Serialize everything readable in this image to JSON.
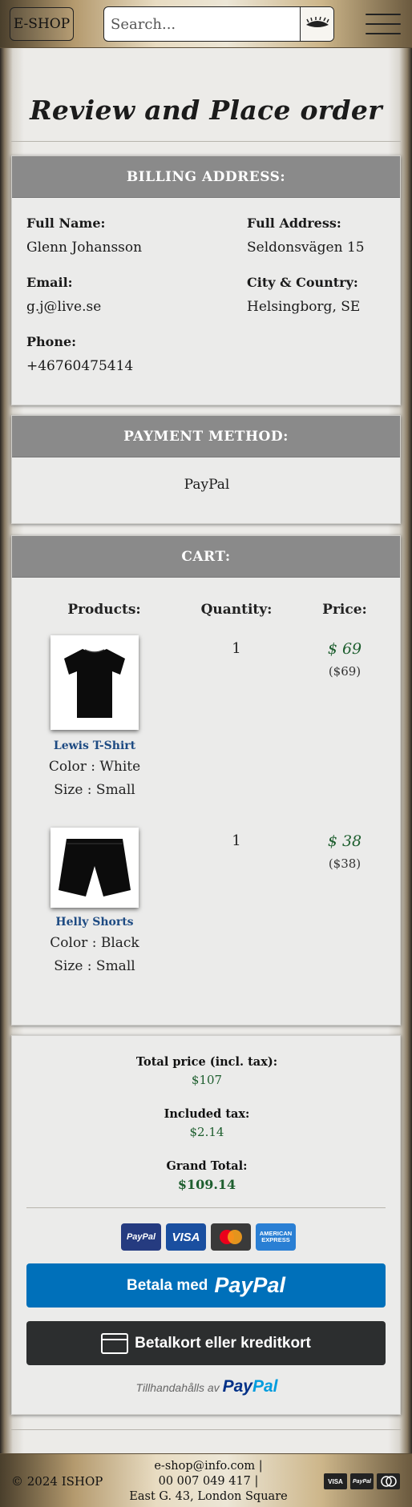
{
  "header": {
    "logo": "E-SHOP",
    "search_placeholder": "Search..."
  },
  "page_title": "Review and Place order",
  "billing": {
    "heading": "BILLING ADDRESS:",
    "full_name_label": "Full Name:",
    "full_name": "Glenn Johansson",
    "full_address_label": "Full Address:",
    "full_address": "Seldonsvägen 15",
    "email_label": "Email:",
    "email": "g.j@live.se",
    "city_label": "City & Country:",
    "city": "Helsingborg, SE",
    "phone_label": "Phone:",
    "phone": "+46760475414"
  },
  "payment": {
    "heading": "PAYMENT METHOD:",
    "method": "PayPal"
  },
  "cart": {
    "heading": "CART:",
    "col_products": "Products:",
    "col_quantity": "Quantity:",
    "col_price": "Price:",
    "items": [
      {
        "name": "Lewis T-Shirt",
        "color": "Color : White",
        "size": "Size : Small",
        "quantity": "1",
        "price": "$ 69",
        "price_sub": "($69)"
      },
      {
        "name": "Helly Shorts",
        "color": "Color : Black",
        "size": "Size : Small",
        "quantity": "1",
        "price": "$ 38",
        "price_sub": "($38)"
      }
    ]
  },
  "totals": {
    "total_label": "Total price (incl. tax):",
    "total_value": "$107",
    "tax_label": "Included tax:",
    "tax_value": "$2.14",
    "grand_label": "Grand Total:",
    "grand_value": "$109.14"
  },
  "checkout": {
    "logos": [
      "PayPal",
      "VISA",
      "mastercard",
      "AMERICAN EXPRESS"
    ],
    "paypal_button_prefix": "Betala med",
    "paypal_button_brand": "PayPal",
    "card_button": "Betalkort eller kreditkort",
    "powered_by": "Tillhandahålls av",
    "powered_brand_a": "Pay",
    "powered_brand_b": "Pal"
  },
  "footer": {
    "copyright": "© 2024 ISHOP",
    "email": "e-shop@info.com |",
    "phone": "00 007 049 417 |",
    "address": "East G. 43, London Square",
    "cards": [
      "VISA",
      "PayPal",
      "mastercard"
    ]
  },
  "colors": {
    "card_header": "#8a8a8a",
    "price_green": "#1d5e2e",
    "product_link": "#1d4a82",
    "paypal_blue": "#0070ba",
    "card_button_dark": "#2c2e2f"
  }
}
